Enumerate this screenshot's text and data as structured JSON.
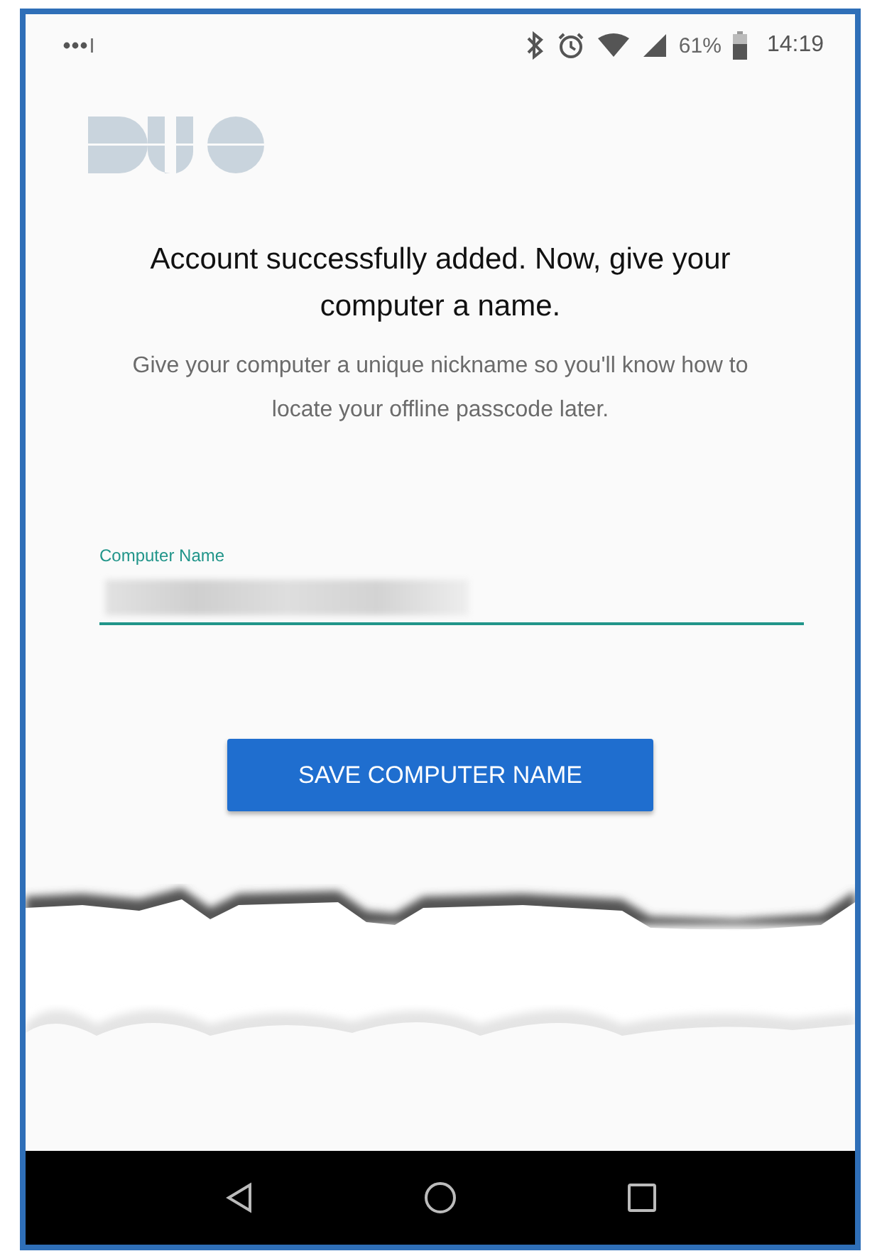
{
  "status_bar": {
    "battery": "61%",
    "time": "14:19"
  },
  "heading": "Account successfully added. Now, give your computer a name.",
  "description": "Give your computer a unique nickname so you'll know how to locate your offline passcode later.",
  "field": {
    "label": "Computer Name",
    "focused": true
  },
  "button": {
    "label": "SAVE COMPUTER NAME"
  }
}
